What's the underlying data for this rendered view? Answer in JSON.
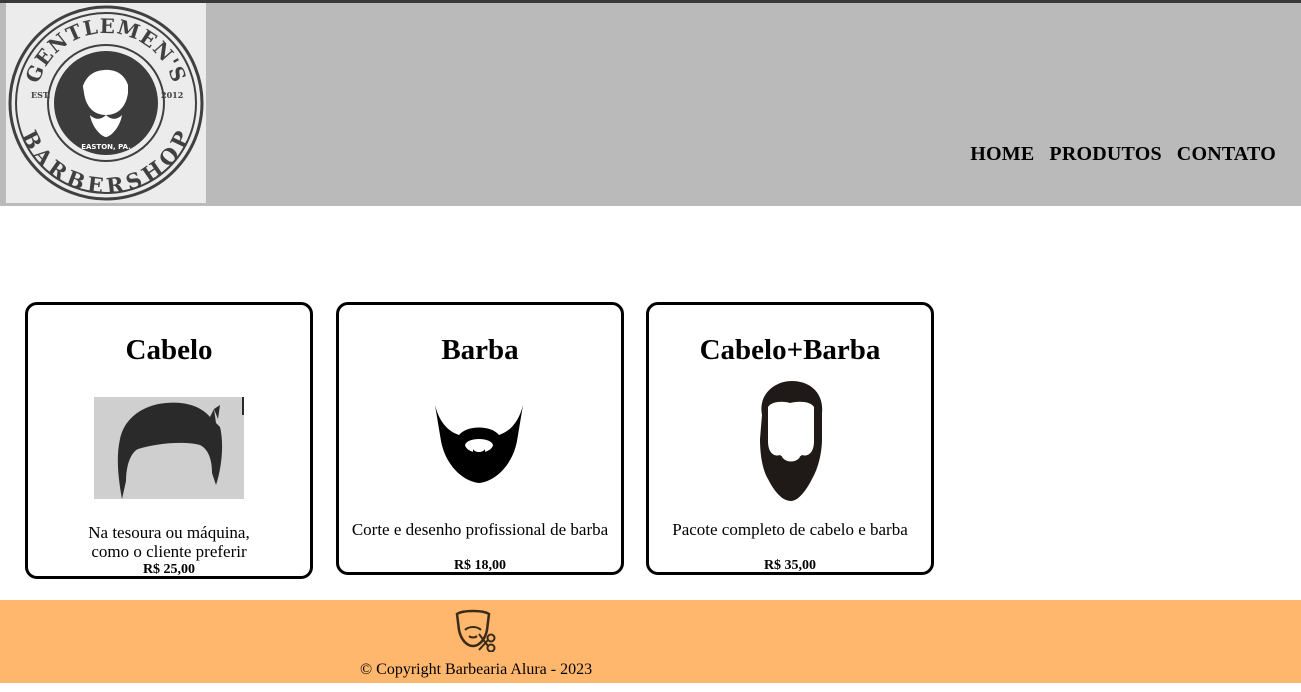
{
  "logo": {
    "alt": "Gentlemen's Barbershop logo",
    "top_text": "GENTLEMEN'S",
    "bottom_text": "BARBERSHOP",
    "est": "EST.",
    "year": "2012",
    "place": "EASTON, PA."
  },
  "nav": {
    "items": [
      "HOME",
      "PRODUTOS",
      "CONTATO"
    ]
  },
  "services": [
    {
      "title": "Cabelo",
      "description": [
        "Na tesoura ou máquina,",
        "como o cliente preferir"
      ],
      "price": "R$ 25,00",
      "image": "hair-image"
    },
    {
      "title": "Barba",
      "description": [
        "Corte e desenho profissional de barba"
      ],
      "price": "R$ 18,00",
      "image": "beard-image"
    },
    {
      "title": "Cabelo+Barba",
      "description": [
        "Pacote completo de cabelo e barba"
      ],
      "price": "R$ 35,00",
      "image": "hair-beard-image"
    }
  ],
  "footer": {
    "icon": "barber-scissors-icon",
    "copyright": "© Copyright Barbearia Alura - 2023"
  },
  "colors": {
    "header_bg": "#bababa",
    "footer_bg": "#ffb76e",
    "card_border": "#000000"
  }
}
